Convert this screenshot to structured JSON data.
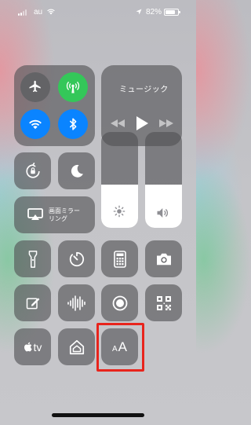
{
  "status_bar": {
    "carrier": "au",
    "battery_percent": "82%",
    "battery_level": 0.82
  },
  "music": {
    "title": "ミュージック"
  },
  "screen_mirroring": {
    "label_line1": "画面ミラー",
    "label_line2": "リング"
  },
  "sliders": {
    "brightness_level": 0.45,
    "volume_level": 0.45
  },
  "apple_tv": {
    "label": "tv"
  },
  "text_size": {
    "label_small": "A",
    "label_large": "A"
  },
  "colors": {
    "airplane_bg": "#636366",
    "cellular_bg": "#34c759",
    "wifi_bg": "#0a84ff",
    "bluetooth_bg": "#0a84ff",
    "highlight": "#e8241c"
  }
}
